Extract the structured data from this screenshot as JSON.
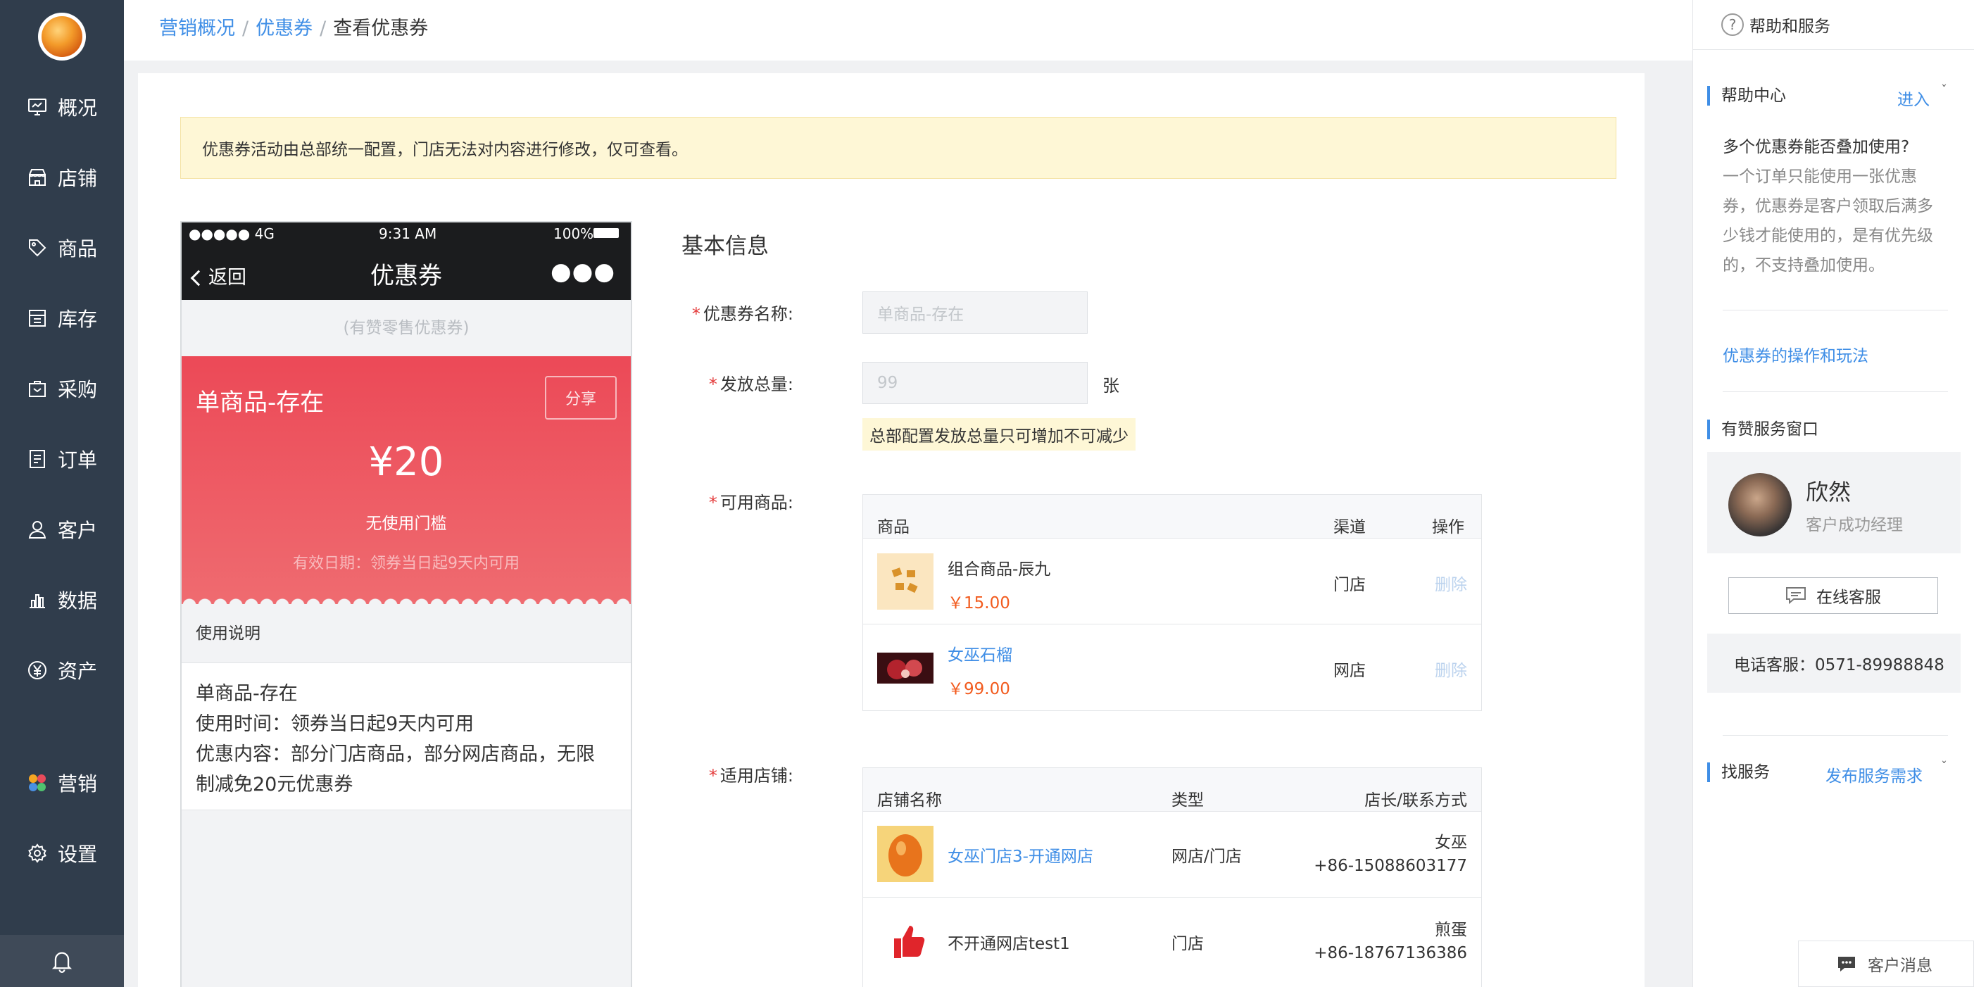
{
  "sidebar": {
    "items": [
      {
        "label": "概况",
        "icon": "dashboard-icon"
      },
      {
        "label": "店铺",
        "icon": "store-icon"
      },
      {
        "label": "商品",
        "icon": "tag-icon"
      },
      {
        "label": "库存",
        "icon": "inventory-icon"
      },
      {
        "label": "采购",
        "icon": "purchase-icon"
      },
      {
        "label": "订单",
        "icon": "order-icon"
      },
      {
        "label": "客户",
        "icon": "user-icon"
      },
      {
        "label": "数据",
        "icon": "chart-icon"
      },
      {
        "label": "资产",
        "icon": "yuan-icon"
      },
      {
        "label": "营销",
        "icon": "marketing-icon"
      },
      {
        "label": "设置",
        "icon": "gear-icon"
      }
    ]
  },
  "breadcrumb": {
    "items": [
      "营销概况",
      "优惠券"
    ],
    "separator": "/",
    "current": "查看优惠券"
  },
  "notice": "优惠券活动由总部统一配置，门店无法对内容进行修改，仅可查看。",
  "phone": {
    "signal": "●●●●● 4G",
    "time": "9:31 AM",
    "battery": "100%",
    "back": "返回",
    "title": "优惠券",
    "shop": "(有赞零售优惠券)",
    "coupon_name": "单商品-存在",
    "share": "分享",
    "amount": "¥20",
    "threshold": "无使用门槛",
    "valid": "有效日期：领券当日起9天内可用",
    "usage_title": "使用说明",
    "usage": [
      "单商品-存在",
      "使用时间：领券当日起9天内可用",
      "优惠内容：部分门店商品，部分网店商品，无限",
      "制减免20元优惠券"
    ]
  },
  "form": {
    "section": "基本信息",
    "name_label": "优惠券名称:",
    "name_value": "单商品-存在",
    "total_label": "发放总量:",
    "total_value": "99",
    "total_unit": "张",
    "total_tip": "总部配置发放总量只可增加不可减少",
    "goods_label": "可用商品:",
    "goods_headers": [
      "商品",
      "渠道",
      "操作"
    ],
    "goods": [
      {
        "name": "组合商品-辰九",
        "price": "￥15.00",
        "channel": "门店",
        "action": "删除"
      },
      {
        "name": "女巫石榴",
        "price": "￥99.00",
        "channel": "网店",
        "action": "删除"
      }
    ],
    "stores_label": "适用店铺:",
    "stores_headers": [
      "店铺名称",
      "类型",
      "店长/联系方式"
    ],
    "stores": [
      {
        "name": "女巫门店3-开通网店",
        "type": "网店/门店",
        "manager": "女巫",
        "phone": "+86-15088603177"
      },
      {
        "name": "不开通网店test1",
        "type": "门店",
        "manager": "煎蛋",
        "phone": "+86-18767136386"
      }
    ]
  },
  "help": {
    "title": "帮助和服务",
    "center": "帮助中心",
    "enter": "进入",
    "question": "多个优惠券能否叠加使用?",
    "answer": "一个订单只能使用一张优惠券，优惠券是客户领取后满多少钱才能使用的，是有优先级的，不支持叠加使用。",
    "article": "优惠券的操作和玩法",
    "window": "有赞服务窗口",
    "agent_name": "欣然",
    "agent_role": "客户成功经理",
    "online": "在线客服",
    "phone": "电话客服：0571-89988848",
    "find": "找服务",
    "publish": "发布服务需求",
    "messages": "客户消息"
  },
  "colors": {
    "sidebar": "#303d4c",
    "link": "#3f8ee6",
    "coupon": "#ec4957",
    "price": "#f25b1e"
  }
}
